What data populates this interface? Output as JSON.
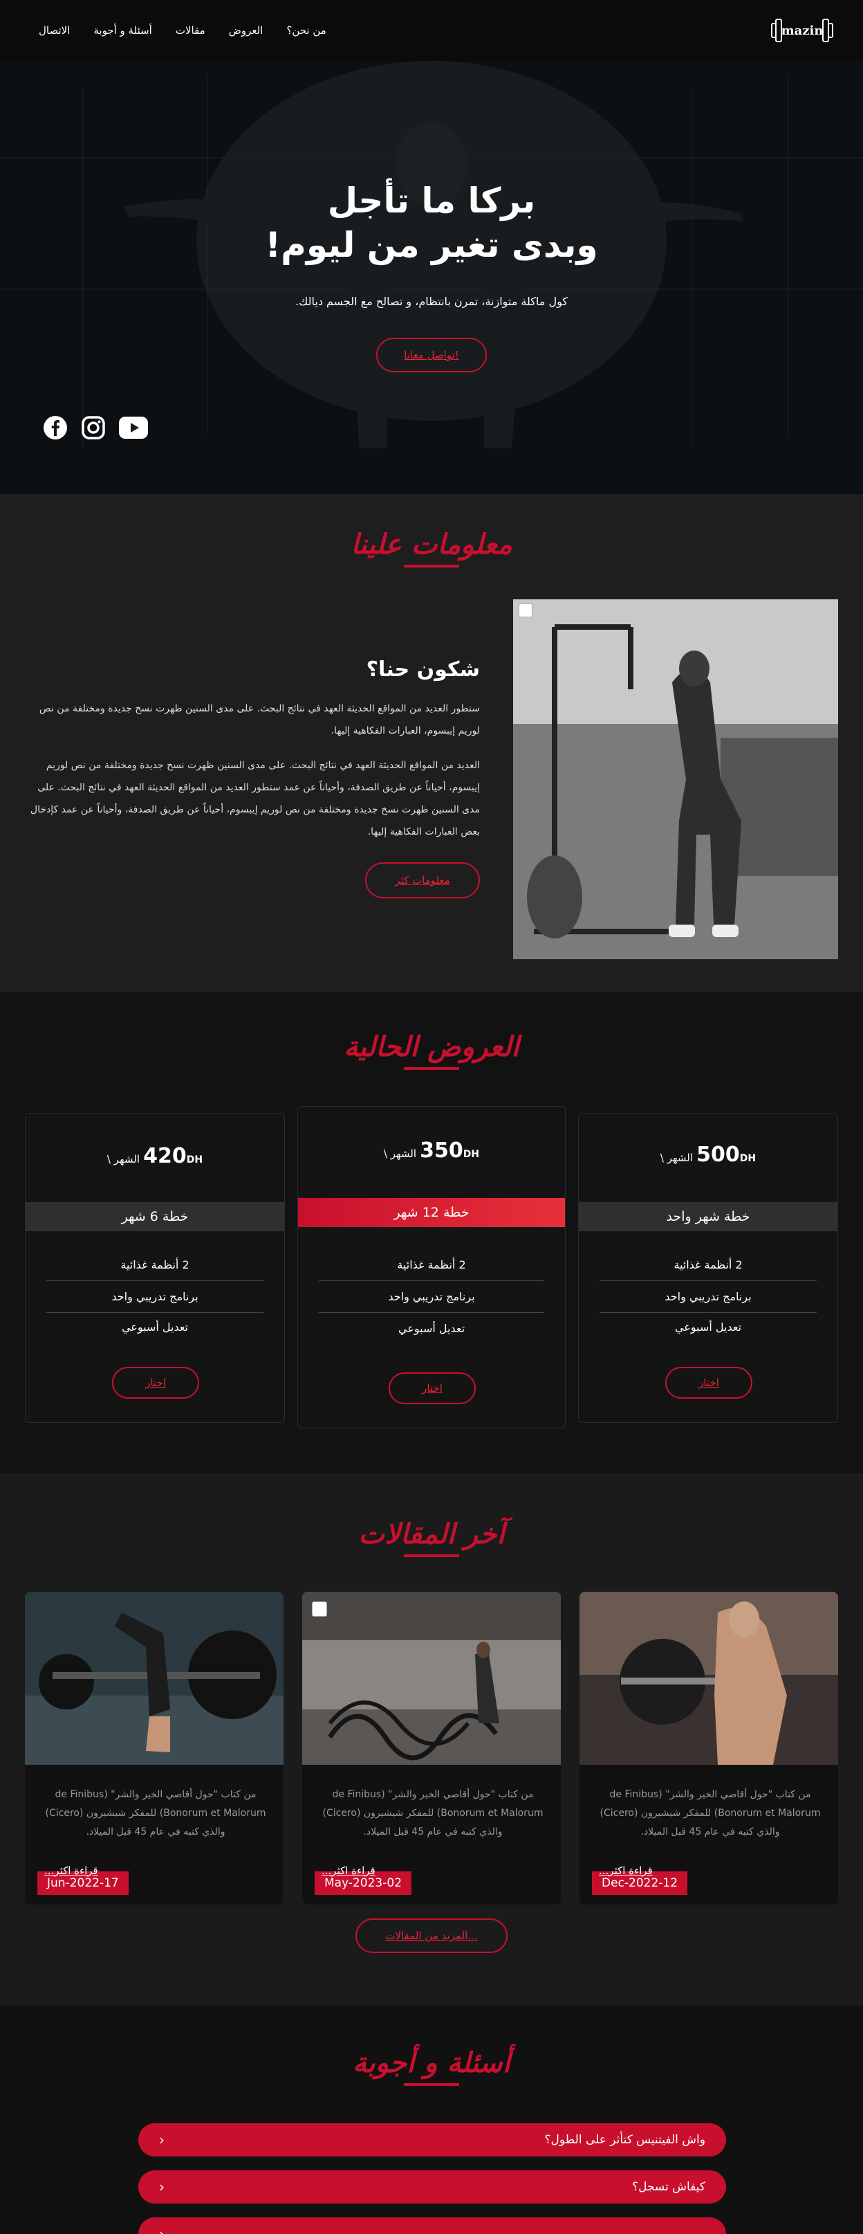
{
  "nav": {
    "links": [
      "من نحن؟",
      "العروض",
      "مقالات",
      "أسئلة و أجوبة",
      "الاتصال"
    ],
    "logo_text": "mazin"
  },
  "hero": {
    "title_line1": "بركا ما تأجل",
    "title_line2": "وبدى تغير من ليوم!",
    "subtitle": "كول ماكلة متوازنة، تمرن بانتظام، و تصالح مع الجسم ديالك.",
    "cta": "تواصل معانا!",
    "socials": [
      "facebook-icon",
      "instagram-icon",
      "youtube-icon"
    ]
  },
  "about": {
    "section_title": "معلومات علينا",
    "heading": "شكون حنا؟",
    "paragraph1": "ستطور العديد من المواقع الحديثة العهد في نتائج البحث. على مدى السنين ظهرت نسخ جديدة ومختلفة من نص لوريم إيبسوم، العبارات الفكاهية إليها.",
    "paragraph2": "العديد من المواقع الحديثة العهد في نتائج البحث. على مدى السنين ظهرت نسخ جديدة ومختلفة من نص لوريم إيبسوم، أحياناً عن طريق الصدفة، وأحياناً عن عمد ستطور العديد من المواقع الحديثة العهد في نتائج البحث. على مدى السنين ظهرت نسخ جديدة ومختلفة من نص لوريم إيبسوم، أحياناً عن طريق الصدفة، وأحياناً عن عمد كإدخال بعض العبارات الفكاهية إليها.",
    "cta": "معلومات كثر"
  },
  "offers": {
    "section_title": "العروض الحالية",
    "per_label": "الشهر \\",
    "currency": "DH",
    "choose": "اختار",
    "plans": [
      {
        "price": "500",
        "name": "خطة شهر واحد",
        "features": [
          "2 أنظمة غذائية",
          "برنامج تدريبي واحد",
          "تعديل أسبوعي"
        ]
      },
      {
        "price": "350",
        "name": "خطة 12 شهر",
        "features": [
          "2 أنظمة غذائية",
          "برنامج تدريبي واحد",
          "تعديل أسبوعي"
        ]
      },
      {
        "price": "420",
        "name": "خطة 6 شهر",
        "features": [
          "2 أنظمة غذائية",
          "برنامج تدريبي واحد",
          "تعديل أسبوعي"
        ]
      }
    ]
  },
  "articles": {
    "section_title": "آخر المقالات",
    "read_more": "قراءة اكثر...",
    "items": [
      {
        "date": "Dec-2022-12",
        "desc": "من كتاب \"حول أقاصي الخير والشر\" (de Finibus Bonorum et Malorum) للمفكر شيشيرون (Cicero) والذي كتبه في عام 45 قبل الميلاد."
      },
      {
        "date": "May-2023-02",
        "desc": "من كتاب \"حول أقاصي الخير والشر\" (de Finibus Bonorum et Malorum) للمفكر شيشيرون (Cicero) والذي كتبه في عام 45 قبل الميلاد."
      },
      {
        "date": "Jun-2022-17",
        "desc": "من كتاب \"حول أقاصي الخير والشر\" (de Finibus Bonorum et Malorum) للمفكر شيشيرون (Cicero) والذي كتبه في عام 45 قبل الميلاد."
      }
    ],
    "more_button": "المزيد من المقالات..."
  },
  "faq": {
    "section_title": "أسئلة و أجوبة",
    "questions": [
      "واش الفيتنيس كتأثر على الطول؟",
      "كيفاش تسجل؟",
      ""
    ]
  },
  "colors": {
    "accent": "#c8102e",
    "dark": "#0b0b0b",
    "panel": "#1e1e1e"
  }
}
